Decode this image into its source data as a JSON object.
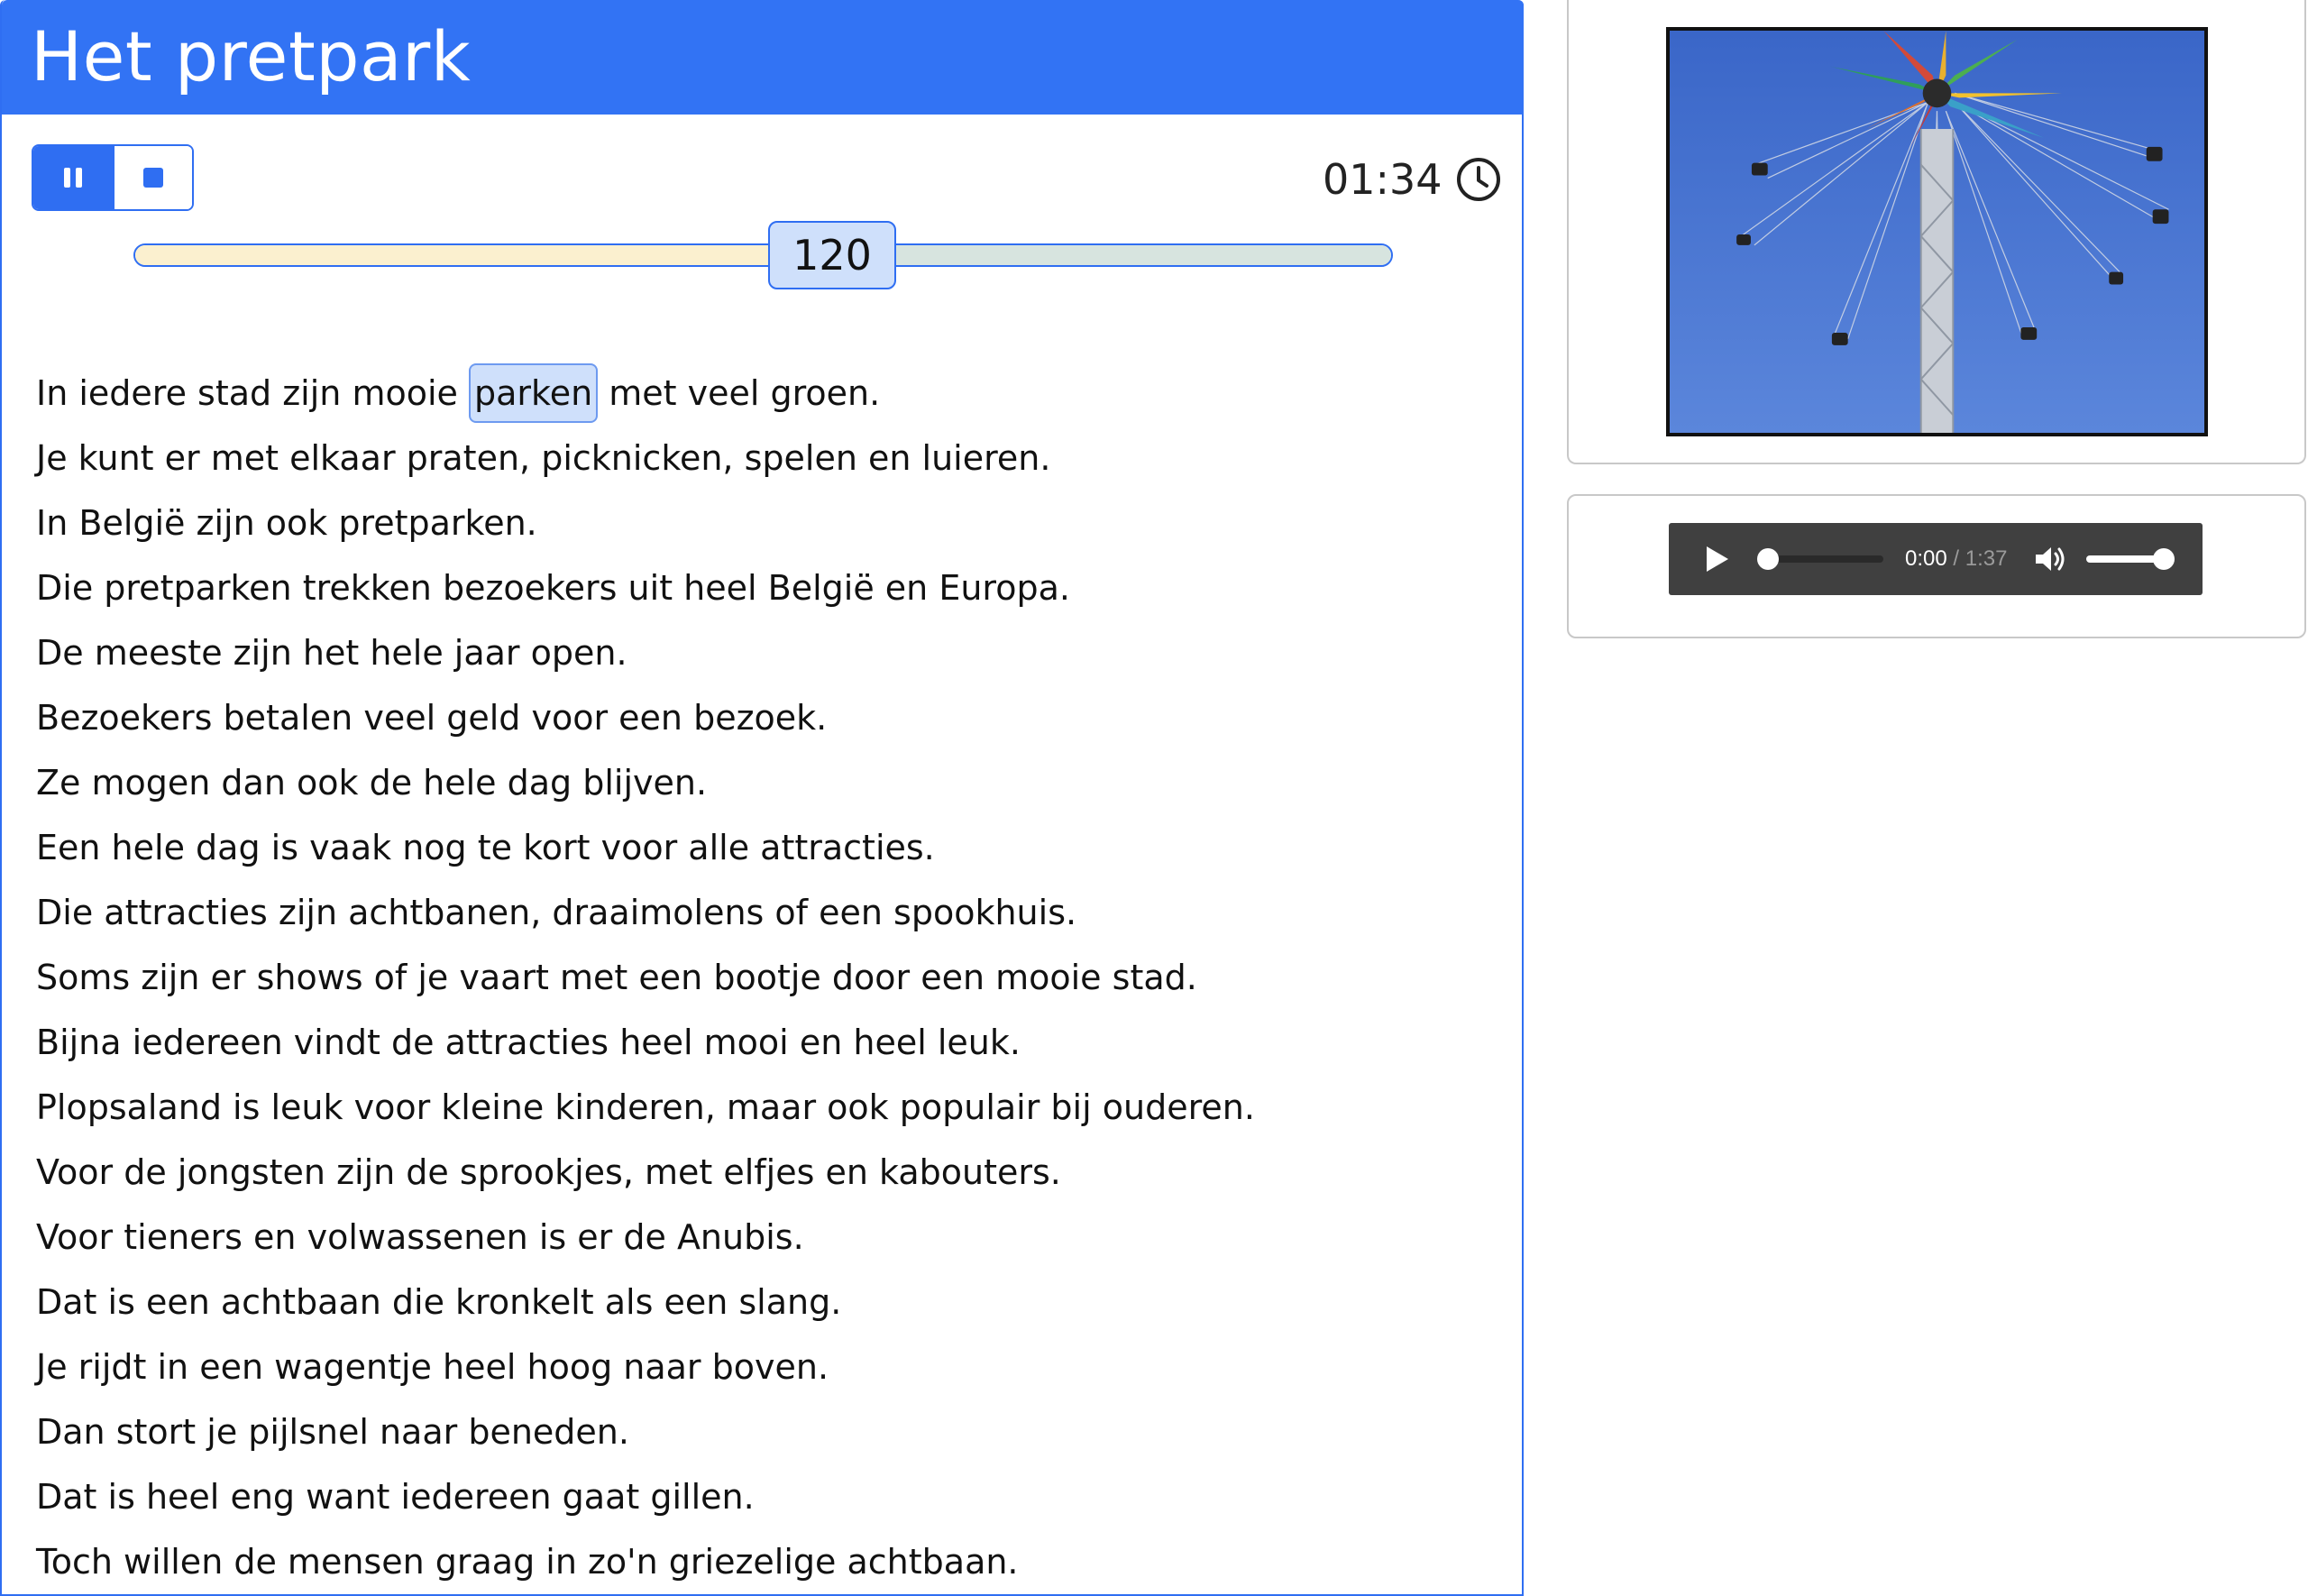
{
  "header": {
    "title": "Het pretpark"
  },
  "controls": {
    "pause_icon": "pause-icon",
    "stop_icon": "stop-icon"
  },
  "timer": {
    "value": "01:34",
    "icon": "clock-icon"
  },
  "slider": {
    "value": "120",
    "fraction": 0.555
  },
  "reading": {
    "highlighted_word": "parken",
    "first_line": {
      "before": "In iedere stad zijn mooie",
      "after": "met veel groen."
    },
    "lines": [
      "Je kunt er met elkaar praten, picknicken, spelen en luieren.",
      "In België zijn ook pretparken.",
      "Die pretparken trekken bezoekers uit heel België en Europa.",
      "De meeste zijn het hele jaar open.",
      "Bezoekers betalen veel geld voor een bezoek.",
      "Ze mogen dan ook de hele dag blijven.",
      "Een hele dag is vaak nog te kort voor alle attracties.",
      "Die attracties zijn achtbanen, draaimolens of een spookhuis.",
      "Soms zijn er shows of je vaart met een bootje door een mooie stad.",
      "Bijna iedereen vindt de attracties heel mooi en heel leuk.",
      "Plopsaland is leuk voor kleine kinderen, maar ook populair bij ouderen.",
      "Voor de jongsten zijn de sprookjes, met elfjes en kabouters.",
      "Voor tieners en volwassenen is er de Anubis.",
      "Dat is een achtbaan die kronkelt als een slang.",
      "Je rijdt in een wagentje heel hoog naar boven.",
      "Dan stort je pijlsnel naar beneden.",
      "Dat is heel eng want iedereen gaat gillen.",
      "Toch willen de mensen graag in zo'n griezelige achtbaan."
    ]
  },
  "image": {
    "icon": "swing-ride-photo"
  },
  "audio": {
    "current": "0:00",
    "separator": " / ",
    "duration": "1:37",
    "play_icon": "play-icon",
    "volume_icon": "volume-icon",
    "progress": 0,
    "volume": 1
  },
  "colors": {
    "accent": "#3273f4",
    "highlight": "#cfe0fb",
    "slider_left": "#fbf0cf",
    "slider_right": "#d7e4df",
    "player_bg": "#404040"
  }
}
